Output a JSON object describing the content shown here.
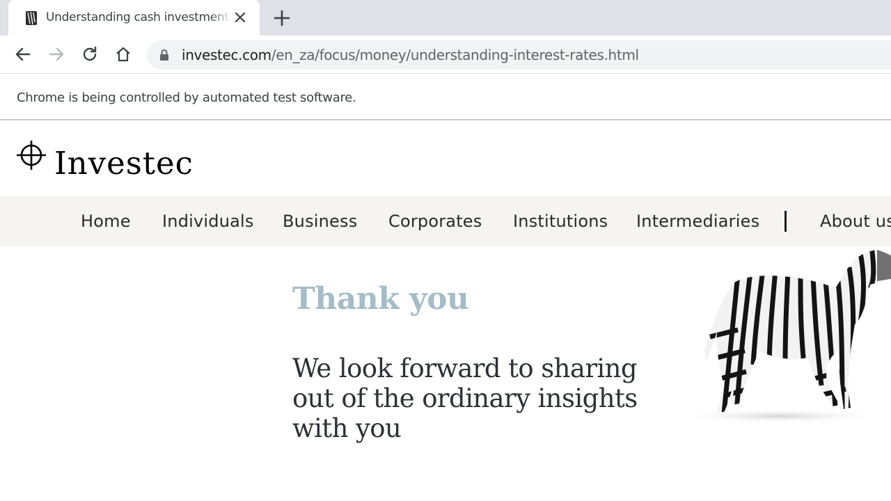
{
  "browser": {
    "tab": {
      "title": "Understanding cash investment in",
      "favicon": "zebra-favicon-icon"
    },
    "address": {
      "domain": "investec.com",
      "path": "/en_za/focus/money/understanding-interest-rates.html"
    },
    "infobar": {
      "message": "Chrome is being controlled by automated test software."
    }
  },
  "site": {
    "brand": "Investec",
    "nav": {
      "items": [
        "Home",
        "Individuals",
        "Business",
        "Corporates",
        "Institutions",
        "Intermediaries",
        "About us"
      ]
    }
  },
  "content": {
    "heading": "Thank you",
    "message": "We look forward to sharing out of the ordinary insights with you"
  },
  "colors": {
    "tabstrip": "#dee1e6",
    "nav_background": "#f5f4f2",
    "heading": "#a6bcc6",
    "message": "#2d3035"
  }
}
